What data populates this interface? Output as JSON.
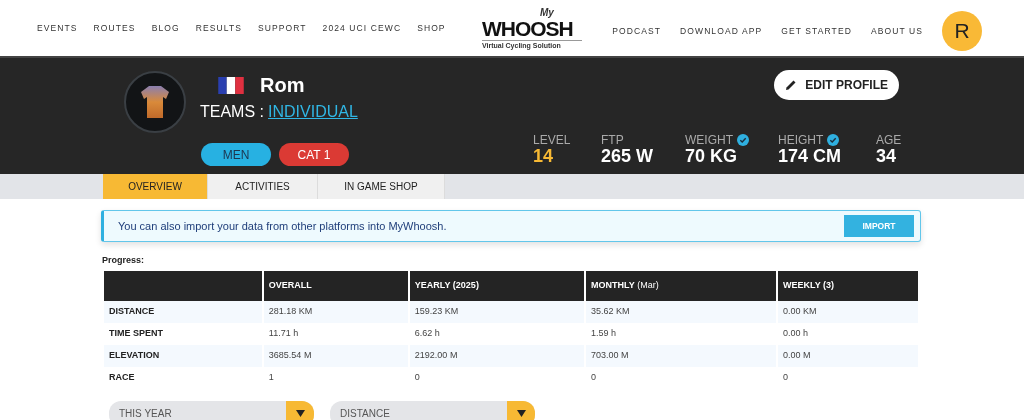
{
  "nav_left": [
    "EVENTS",
    "ROUTES",
    "BLOG",
    "RESULTS",
    "SUPPORT",
    "2024 UCI CEWC",
    "SHOP"
  ],
  "logo": {
    "prefix": "My",
    "name": "WHOOSH",
    "tagline": "Virtual Cycling Solution"
  },
  "nav_right": [
    "PODCAST",
    "DOWNLOAD APP",
    "GET STARTED",
    "ABOUT US"
  ],
  "avatar": {
    "initial": "R"
  },
  "profile": {
    "name": "Rom",
    "teams_label": "TEAMS :",
    "team": "INDIVIDUAL",
    "edit_button": "EDIT PROFILE",
    "tags": [
      {
        "label": "MEN",
        "color": "#27b1e2"
      },
      {
        "label": "CAT 1",
        "color": "#db3a34"
      }
    ],
    "stats": [
      {
        "label": "LEVEL",
        "value": "14",
        "verified": false,
        "highlight": true
      },
      {
        "label": "FTP",
        "value": "265 W",
        "verified": false,
        "highlight": false
      },
      {
        "label": "WEIGHT",
        "value": "70 KG",
        "verified": true,
        "highlight": false
      },
      {
        "label": "HEIGHT",
        "value": "174 CM",
        "verified": true,
        "highlight": false
      },
      {
        "label": "AGE",
        "value": "34",
        "verified": false,
        "highlight": false
      }
    ]
  },
  "tabs": [
    {
      "label": "OVERVIEW",
      "selected": true
    },
    {
      "label": "ACTIVITIES",
      "selected": false
    },
    {
      "label": "IN GAME SHOP",
      "selected": false
    }
  ],
  "alert": {
    "text": "You can also import your data from other platforms into MyWhoosh.",
    "button": "IMPORT"
  },
  "progress": {
    "title": "Progress:",
    "columns": [
      "",
      "OVERALL",
      "YEARLY (2025)",
      "**MONTHLY** (Mar)",
      "WEEKLY (3)"
    ],
    "rows": [
      [
        "DISTANCE",
        "281.18 KM",
        "159.23 KM",
        "35.62 KM",
        "0.00 KM"
      ],
      [
        "TIME SPENT",
        "11.71 h",
        "6.62 h",
        "1.59 h",
        "0.00 h"
      ],
      [
        "ELEVATION",
        "3685.54 M",
        "2192.00 M",
        "703.00 M",
        "0.00 M"
      ],
      [
        "RACE",
        "1",
        "0",
        "0",
        "0"
      ]
    ]
  },
  "filters": [
    {
      "value": "THIS YEAR"
    },
    {
      "value": "DISTANCE"
    }
  ]
}
